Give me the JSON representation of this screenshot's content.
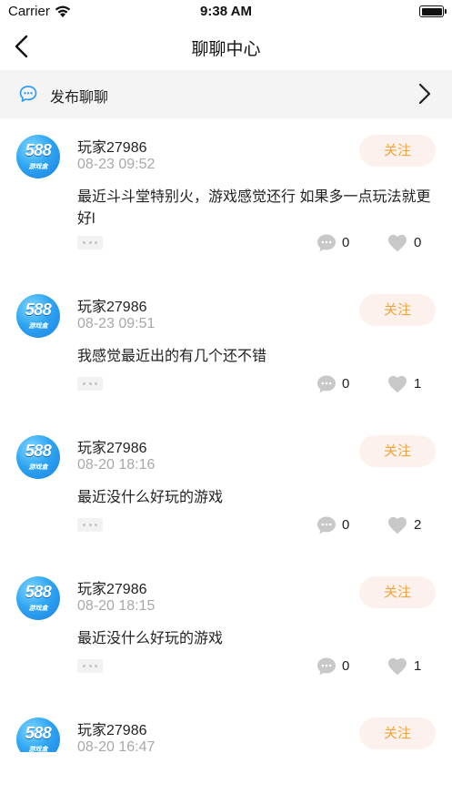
{
  "status_bar": {
    "carrier": "Carrier",
    "time": "9:38 AM"
  },
  "nav": {
    "title": "聊聊中心"
  },
  "post_bar": {
    "label": "发布聊聊"
  },
  "follow_label": "关注",
  "avatar": {
    "number": "588",
    "subtitle": "游戏盒"
  },
  "colors": {
    "follow_text": "#f0a43a",
    "follow_bg": "#fdf1ed",
    "timestamp": "#a8a8a8",
    "avatar_blue": "#2fa6f2",
    "post_bar_bg": "#f4f4f4"
  },
  "posts": [
    {
      "username": "玩家27986",
      "time": "08-23 09:52",
      "content": "最近斗斗堂特别火，游戏感觉还行 如果多一点玩法就更好l",
      "comments": "0",
      "likes": "0"
    },
    {
      "username": "玩家27986",
      "time": "08-23 09:51",
      "content": "我感觉最近出的有几个还不错",
      "comments": "0",
      "likes": "1"
    },
    {
      "username": "玩家27986",
      "time": "08-20 18:16",
      "content": "最近没什么好玩的游戏",
      "comments": "0",
      "likes": "2"
    },
    {
      "username": "玩家27986",
      "time": "08-20 18:15",
      "content": "最近没什么好玩的游戏",
      "comments": "0",
      "likes": "1"
    },
    {
      "username": "玩家27986",
      "time": "08-20 16:47",
      "content": "",
      "comments": "",
      "likes": ""
    }
  ]
}
